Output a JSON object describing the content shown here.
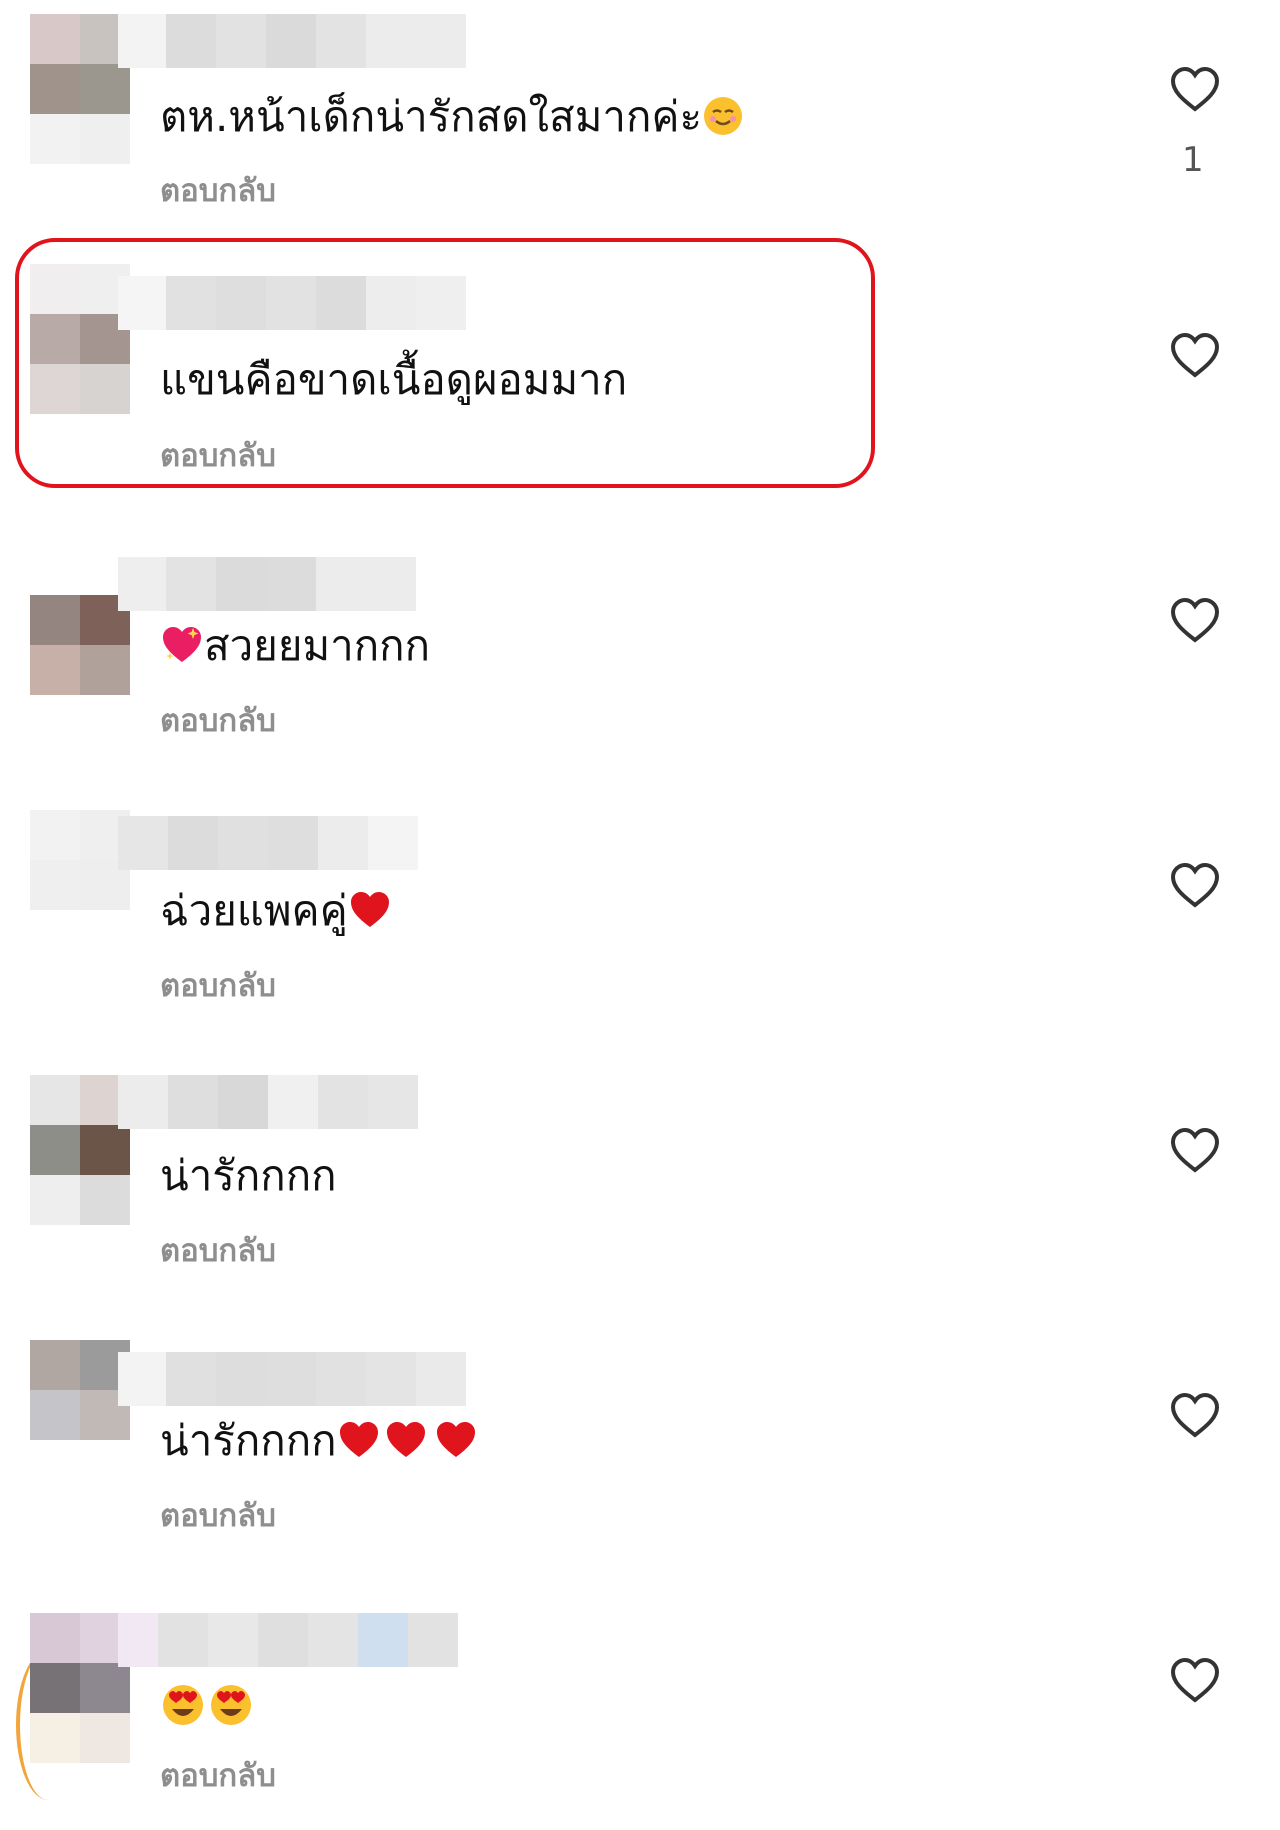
{
  "comments": [
    {
      "text": "ตห.หน้าเด็กน่ารักสดใสมากค่ะ",
      "reply": "ตอบกลับ",
      "likes": "1"
    },
    {
      "text": "แขนคือขาดเนื้อดูผอมมาก",
      "reply": "ตอบกลับ",
      "likes": ""
    },
    {
      "text": "สวยยมากกก",
      "reply": "ตอบกลับ",
      "likes": ""
    },
    {
      "text": "ฉ่วยแพคคู่",
      "reply": "ตอบกลับ",
      "likes": ""
    },
    {
      "text": "น่ารักกกก",
      "reply": "ตอบกลับ",
      "likes": ""
    },
    {
      "text": "น่ารักกกก",
      "reply": "ตอบกลับ",
      "likes": ""
    },
    {
      "text": "",
      "reply": "ตอบกลับ",
      "likes": ""
    }
  ],
  "colors": {
    "highlight": "#e0141d",
    "reply": "#8e8e8e",
    "heart_icon": "#333333"
  },
  "icons": {
    "like": "heart-outline-icon",
    "blurred_avatar": "avatar-pixelated",
    "blurred_username": "username-pixelated"
  }
}
